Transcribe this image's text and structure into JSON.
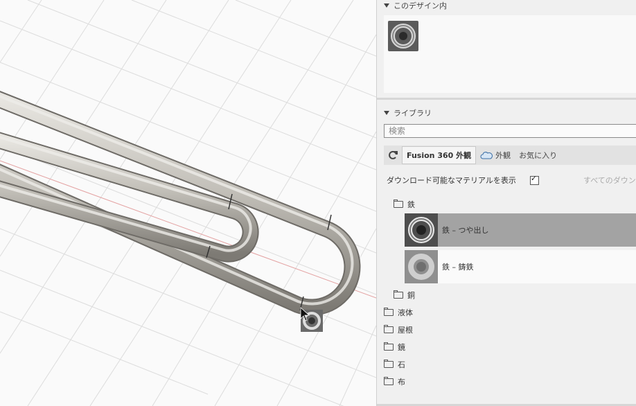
{
  "panel": {
    "in_design_label": "このデザイン内",
    "library_label": "ライブラリ",
    "search_placeholder": "検索",
    "tabs": [
      {
        "label": "Fusion 360 外観",
        "active": true
      },
      {
        "label": "外観",
        "active": false
      },
      {
        "label": "お気に入り",
        "active": false
      }
    ],
    "download_label": "ダウンロード可能なマテリアルを表示",
    "download_checked": true,
    "download_all": "すべてのダウンロー",
    "tree": {
      "iron_folder": "鉄",
      "materials": [
        {
          "label": "鉄 – つや出し",
          "selected": true
        },
        {
          "label": "鉄 – 鋳鉄",
          "selected": false
        }
      ],
      "copper_folder": "銅",
      "folders": [
        "液体",
        "屋根",
        "鏡",
        "石",
        "布"
      ]
    }
  },
  "colors": {
    "selected_row": "#a3a3a3",
    "pipe": "#b5b2ab",
    "grid": "#dcdcdc"
  },
  "icons": [
    "refresh-icon",
    "cloud-icon",
    "folder-icon",
    "checkbox-icon",
    "cursor-icon"
  ]
}
